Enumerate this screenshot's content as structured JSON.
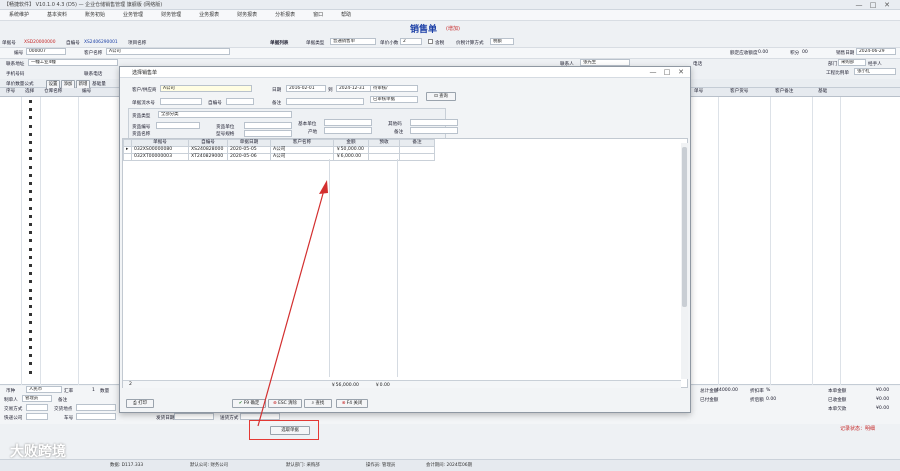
{
  "app": {
    "title": "【畅捷软件】 V10.1.0 4.3 (D5) — 企业仓储销售管理 旗舰版 (网络版)",
    "window_controls": [
      "—",
      "□",
      "✕"
    ]
  },
  "menu": [
    "系统维护",
    "基本资料",
    "账务初始",
    "业务管理",
    "财务管理",
    "业务报表",
    "财务报表",
    "分析报表",
    "窗口",
    "帮助"
  ],
  "form": {
    "title": "销售单",
    "mode": "(增加)",
    "order_label": "单据号",
    "order_no": "XSD20000000",
    "self_no_label": "自编号",
    "self_no": "XS2406290001",
    "project_label": "项目名称",
    "list_type_label": "单据列表",
    "doc_type_label": "单据类型",
    "doc_type": "普通销售单",
    "unit_price_label": "单价小数",
    "unit_price": "2",
    "tax_label": "含税",
    "calc_label": "价税计算方式",
    "calc_value": "税额",
    "code_label": "编号",
    "code": "000007",
    "customer_label": "客户名称",
    "customer": "A公司",
    "address_label": "联系地址",
    "address": "一幢工业4幢",
    "mobile_label": "手机号码",
    "contact_label": "联系电话",
    "seller_label": "联系人",
    "seller": "张先生",
    "phone_label": "电话",
    "credit_label": "额定应收额度",
    "credit": "0.00",
    "score_label": "积分",
    "score": "00",
    "date_label": "销售日期",
    "date": "2024-06-29",
    "dept_label": "部门",
    "dept": "采购部",
    "handler_label": "经手人",
    "handler": "张小红",
    "project2_label": "工程比例单",
    "calc_formula": "单价数量公式",
    "tabs": [
      "设置",
      "添加",
      "新增"
    ],
    "tab_extra": "基础量"
  },
  "main_grid": {
    "columns_left": [
      "序号",
      "选择",
      "仓库名称",
      "编号"
    ],
    "columns_right": [
      "单号",
      "客户货号",
      "客户备注",
      "基础"
    ],
    "row_marks": 34
  },
  "bottom_form": {
    "currency_label": "币种",
    "currency": "人民币",
    "rate_label": "汇率",
    "rate": "1",
    "order_count": "数量",
    "maker_label": "制单人",
    "maker": "管理员",
    "remark_label": "备注",
    "delivery_label": "交货地点",
    "trans_label": "交易方式",
    "expr_label": "快递公司",
    "car_label": "车号",
    "ship_date_label": "发货日期",
    "pay_label": "送货方式",
    "total_label": "总计金额",
    "total": "44000.00",
    "paid_label": "已付金额",
    "discount_label": "折扣率",
    "discount": "%",
    "disc_amt_label": "折后额",
    "disc_amt": "0.00",
    "profit_label": "本单金额",
    "profit": "¥0.00",
    "received_label": "已收金额",
    "received": "¥0.00",
    "balance_label": "本单欠款",
    "balance": "¥0.00",
    "status": "记录状态：明细"
  },
  "select_button": "选取单据",
  "dialog": {
    "title": "选择销售单",
    "window_controls": [
      "—",
      "□",
      "✕"
    ],
    "customer_label": "客户/供应商",
    "customer": "A公司",
    "date_label": "日期",
    "date_from": "2016-02-01",
    "to_label": "到",
    "date_to": "2024-12-31",
    "status_select": "待审核/",
    "flow_select": "已审核单据",
    "query_button": "查询",
    "doc_no_label": "单据流水号",
    "self_no_label": "自编号",
    "remark_label": "备注",
    "product_class_label": "货品类型",
    "product_class": "全部分类",
    "product_no_label": "货品编号",
    "product_name_label": "货品名称",
    "product_unit_label": "货品单位",
    "product_model_label": "型号规格",
    "base_unit_label": "基本单位",
    "origin_label": "产地",
    "alt_unit_label": "其他码",
    "remark2_label": "备注",
    "table": {
      "headers": [
        "单据号",
        "自编号",
        "单据日期",
        "客户名称",
        "金额",
        "预收",
        "备注"
      ],
      "rows": [
        [
          "032XS00000080",
          "XS240828000",
          "2020-05-05",
          "A公司",
          "￥50,000.00",
          "",
          ""
        ],
        [
          "032XT00000003",
          "XT240829000",
          "2020-05-06",
          "A公司",
          "￥6,000.00",
          "",
          ""
        ]
      ],
      "footer_count": "2",
      "footer_total": "￥56,000.00",
      "footer_prepay": "￥0.00"
    },
    "buttons": {
      "print": "打印",
      "confirm": "F9 确定",
      "clear": "ESC 清除",
      "select": "查找",
      "cancel": "F4 关闭"
    }
  },
  "taskbar": {
    "watermark": "大败跨境",
    "items": [
      "数据: D117.333",
      "默认公司: 财务公司",
      "默认部门: 采购部",
      "操作员: 管理员",
      "会计期间: 2024年06期"
    ]
  },
  "colors": {
    "arrow": "#d32f2f",
    "highlight_box": "#e53935",
    "form_title": "#1b3fa6",
    "total": "#c62828"
  }
}
